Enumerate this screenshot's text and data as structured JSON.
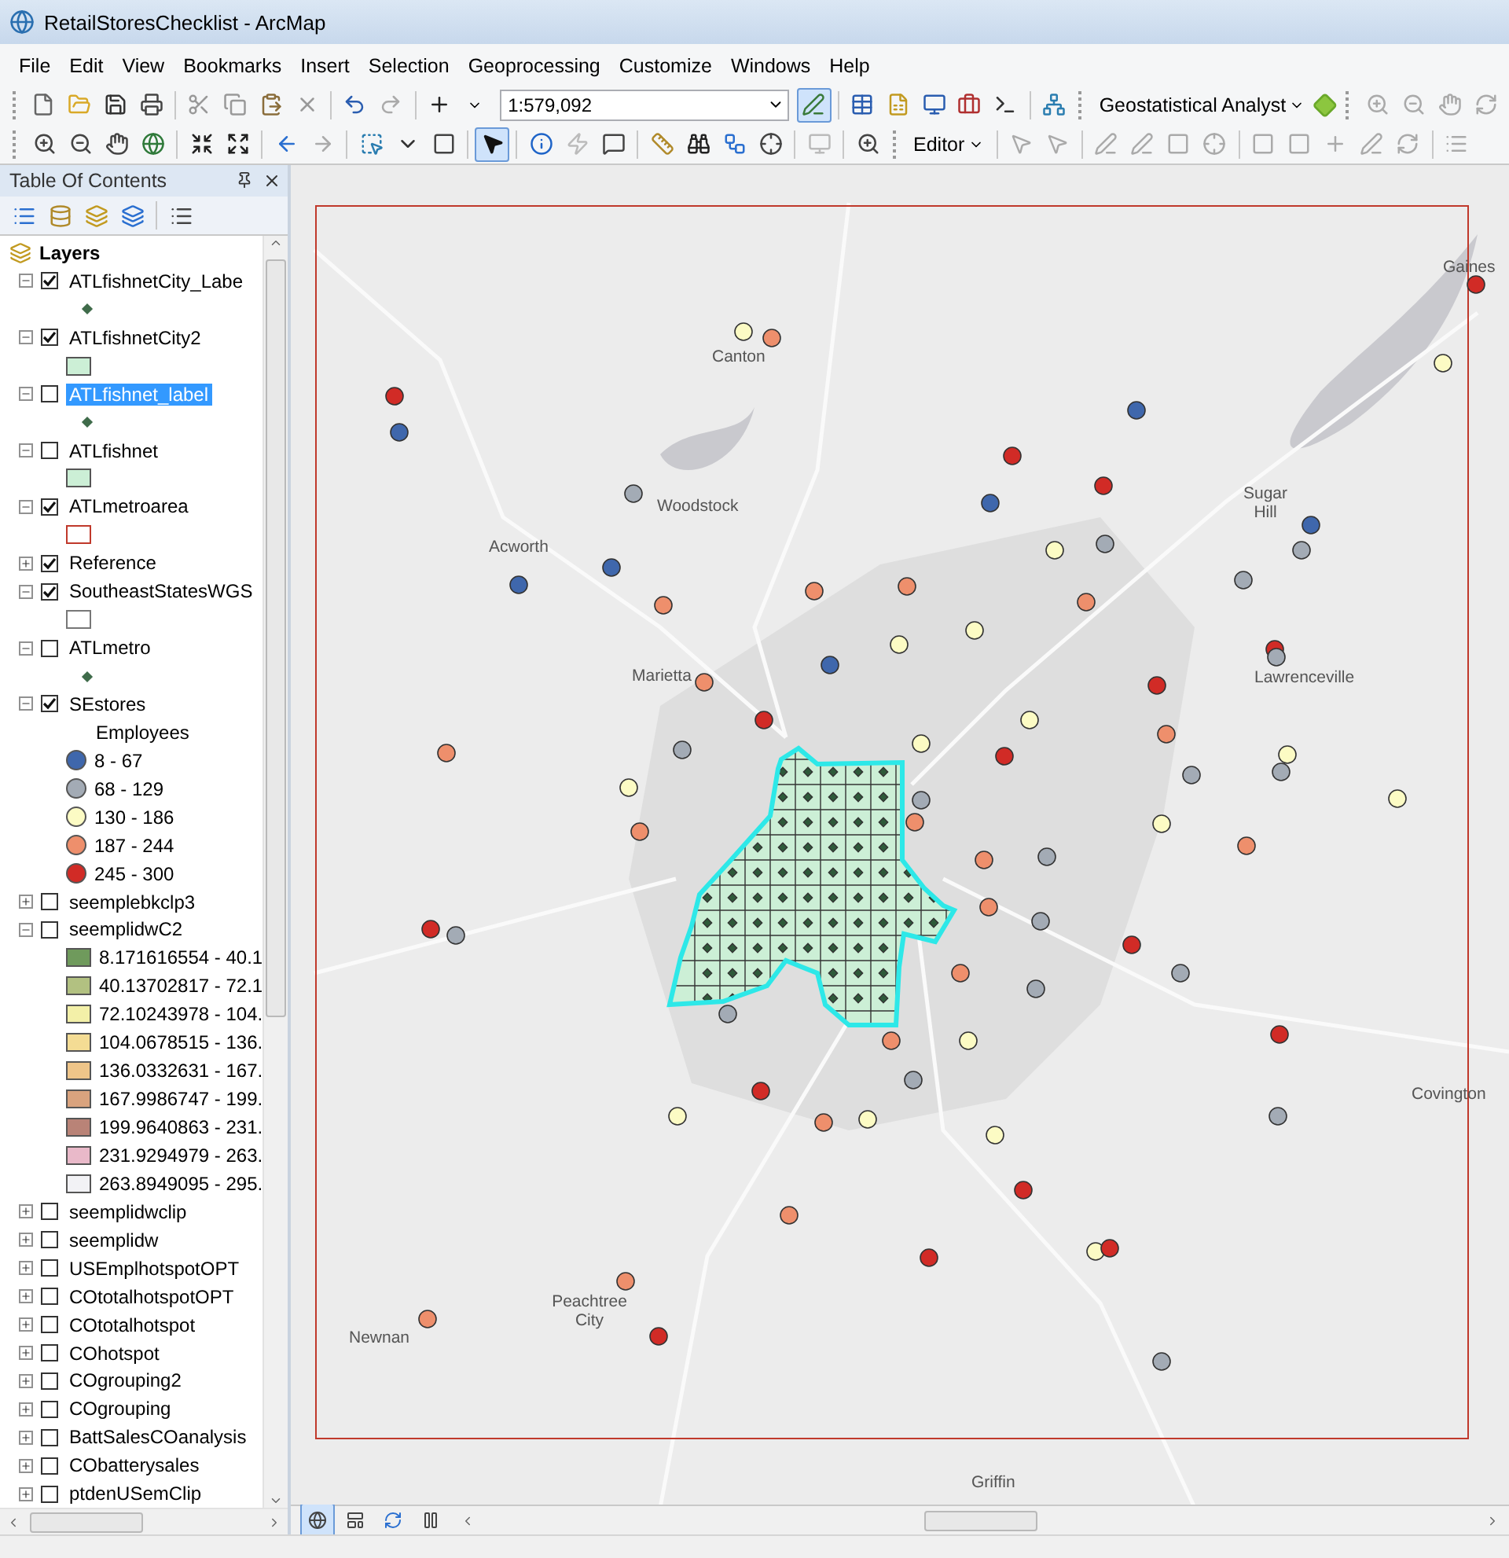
{
  "window": {
    "title": "RetailStoresChecklist - ArcMap"
  },
  "menu": [
    "File",
    "Edit",
    "View",
    "Bookmarks",
    "Insert",
    "Selection",
    "Geoprocessing",
    "Customize",
    "Windows",
    "Help"
  ],
  "toolbar_1": {
    "scale": "1:579,092",
    "analyst": "Geostatistical Analyst",
    "editing_tool": {
      "selected": true
    }
  },
  "toolbar_2": {
    "select_tool": {
      "selected": true
    },
    "editor": "Editor"
  },
  "toc": {
    "title": "Table Of Contents",
    "root": "Layers",
    "layers": [
      {
        "name": "ATLfishnetCity_Labe",
        "checked": true,
        "expanded": true,
        "selected": false,
        "legend": {
          "items": [
            {
              "kind": "marker",
              "color": "#3f6b4a"
            }
          ]
        }
      },
      {
        "name": "ATLfishnetCity2",
        "checked": true,
        "expanded": true,
        "selected": false,
        "legend": {
          "items": [
            {
              "kind": "patch",
              "color": "#ccefd6"
            }
          ]
        }
      },
      {
        "name": "ATLfishnet_label",
        "checked": false,
        "expanded": true,
        "selected": true,
        "legend": {
          "items": [
            {
              "kind": "marker",
              "color": "#3f6b4a"
            }
          ]
        }
      },
      {
        "name": "ATLfishnet",
        "checked": false,
        "expanded": true,
        "selected": false,
        "legend": {
          "items": [
            {
              "kind": "patch",
              "color": "#ccefd6"
            }
          ]
        }
      },
      {
        "name": "ATLmetroarea",
        "checked": true,
        "expanded": true,
        "selected": false,
        "legend": {
          "items": [
            {
              "kind": "outline",
              "color": "#c0392b"
            }
          ]
        }
      },
      {
        "name": "Reference",
        "checked": true,
        "expanded": false,
        "selected": false
      },
      {
        "name": "SoutheastStatesWGS",
        "checked": true,
        "expanded": true,
        "selected": false,
        "legend": {
          "items": [
            {
              "kind": "outline",
              "color": "#777777"
            }
          ]
        }
      },
      {
        "name": "ATLmetro",
        "checked": false,
        "expanded": true,
        "selected": false,
        "legend": {
          "items": [
            {
              "kind": "marker",
              "color": "#3f6b4a"
            }
          ]
        }
      },
      {
        "name": "SEstores",
        "checked": true,
        "expanded": true,
        "selected": false,
        "legend": {
          "heading": "Employees",
          "items": [
            {
              "kind": "circle",
              "color": "#3f67ac",
              "label": "8 - 67"
            },
            {
              "kind": "circle",
              "color": "#a3abb5",
              "label": "68 - 129"
            },
            {
              "kind": "circle",
              "color": "#fcfbc4",
              "label": "130 - 186"
            },
            {
              "kind": "circle",
              "color": "#ee8f6c",
              "label": "187 - 244"
            },
            {
              "kind": "circle",
              "color": "#d12b26",
              "label": "245 - 300"
            }
          ]
        }
      },
      {
        "name": "seemplebkclp3",
        "checked": false,
        "expanded": false,
        "selected": false
      },
      {
        "name": "seemplidwC2",
        "checked": false,
        "expanded": true,
        "selected": false,
        "legend": {
          "items": [
            {
              "kind": "patch",
              "color": "#6f9a5c",
              "label": "8.171616554 - 40.1"
            },
            {
              "kind": "patch",
              "color": "#b2c181",
              "label": "40.13702817 - 72.1"
            },
            {
              "kind": "patch",
              "color": "#f3f0a8",
              "label": "72.10243978 - 104."
            },
            {
              "kind": "patch",
              "color": "#f4dc94",
              "label": "104.0678515 - 136."
            },
            {
              "kind": "patch",
              "color": "#efc589",
              "label": "136.0332631 - 167."
            },
            {
              "kind": "patch",
              "color": "#d9a37e",
              "label": "167.9986747 - 199."
            },
            {
              "kind": "patch",
              "color": "#b98377",
              "label": "199.9640863 - 231."
            },
            {
              "kind": "patch",
              "color": "#e9b9c9",
              "label": "231.9294979 - 263."
            },
            {
              "kind": "patch",
              "color": "#f2f2f5",
              "label": "263.8949095 - 295."
            }
          ]
        }
      },
      {
        "name": "seemplidwclip",
        "checked": false,
        "expanded": false,
        "selected": false
      },
      {
        "name": "seemplidw",
        "checked": false,
        "expanded": false,
        "selected": false
      },
      {
        "name": "USEmplhotspotOPT",
        "checked": false,
        "expanded": false,
        "selected": false
      },
      {
        "name": "COtotalhotspotOPT",
        "checked": false,
        "expanded": false,
        "selected": false
      },
      {
        "name": "COtotalhotspot",
        "checked": false,
        "expanded": false,
        "selected": false
      },
      {
        "name": "COhotspot",
        "checked": false,
        "expanded": false,
        "selected": false
      },
      {
        "name": "COgrouping2",
        "checked": false,
        "expanded": false,
        "selected": false
      },
      {
        "name": "COgrouping",
        "checked": false,
        "expanded": false,
        "selected": false
      },
      {
        "name": "BattSalesCOanalysis",
        "checked": false,
        "expanded": false,
        "selected": false
      },
      {
        "name": "CObatterysales",
        "checked": false,
        "expanded": false,
        "selected": false
      },
      {
        "name": "ptdenUSemClip",
        "checked": false,
        "expanded": false,
        "selected": false
      }
    ]
  },
  "map_labels": [
    "Canton",
    "Woodstock",
    "Acworth",
    "Sugar Hill",
    "Marietta",
    "Lawrenceville",
    "Gaines",
    "Covington",
    "Newnan",
    "Peachtree City",
    "Griffin"
  ]
}
